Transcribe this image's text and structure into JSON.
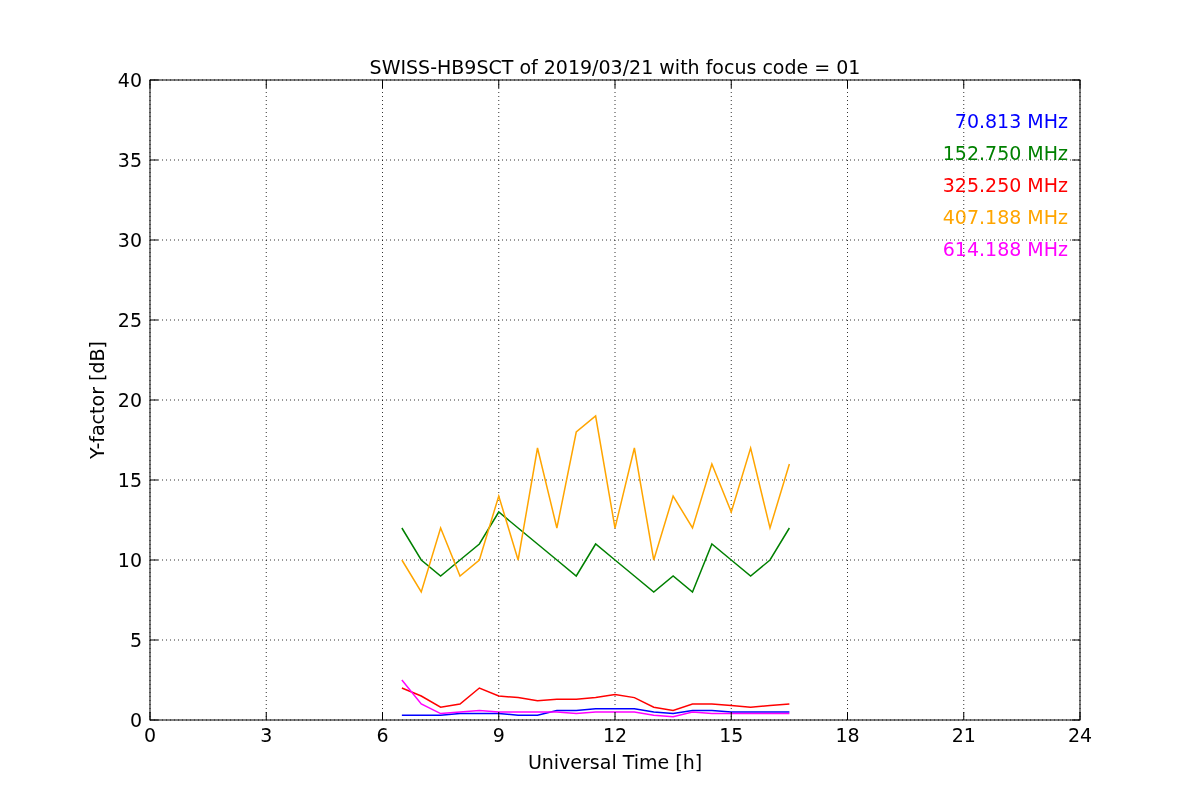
{
  "chart_data": {
    "type": "line",
    "title": "SWISS-HB9SCT of 2019/03/21 with focus code = 01",
    "xlabel": "Universal Time [h]",
    "ylabel": "Y-factor [dB]",
    "x": [
      6.5,
      7,
      7.5,
      8,
      8.5,
      9,
      9.5,
      10,
      10.5,
      11,
      11.5,
      12,
      12.5,
      13,
      13.5,
      14,
      14.5,
      15,
      15.5,
      16,
      16.5
    ],
    "series": [
      {
        "name": "70.813 MHz",
        "color": "#0000ff",
        "values": [
          0.3,
          0.3,
          0.3,
          0.4,
          0.4,
          0.4,
          0.3,
          0.3,
          0.6,
          0.6,
          0.7,
          0.7,
          0.7,
          0.5,
          0.4,
          0.6,
          0.6,
          0.5,
          0.5,
          0.5,
          0.5
        ]
      },
      {
        "name": "152.750 MHz",
        "color": "#008000",
        "values": [
          12,
          10,
          9,
          10,
          11,
          13,
          12,
          11,
          10,
          9,
          11,
          10,
          9,
          8,
          9,
          8,
          11,
          10,
          9,
          10,
          12
        ]
      },
      {
        "name": "325.250 MHz",
        "color": "#ff0000",
        "values": [
          2,
          1.5,
          0.8,
          1,
          2,
          1.5,
          1.4,
          1.2,
          1.3,
          1.3,
          1.4,
          1.6,
          1.4,
          0.8,
          0.6,
          1,
          1,
          0.9,
          0.8,
          0.9,
          1
        ]
      },
      {
        "name": "407.188 MHz",
        "color": "#ffa500",
        "values": [
          10,
          8,
          12,
          9,
          10,
          14,
          10,
          17,
          12,
          18,
          19,
          12,
          17,
          10,
          14,
          12,
          16,
          13,
          17,
          12,
          16
        ]
      },
      {
        "name": "614.188 MHz",
        "color": "#ff00ff",
        "values": [
          2.5,
          1,
          0.4,
          0.5,
          0.6,
          0.5,
          0.5,
          0.5,
          0.5,
          0.4,
          0.5,
          0.5,
          0.5,
          0.3,
          0.2,
          0.5,
          0.4,
          0.4,
          0.4,
          0.4,
          0.4
        ]
      }
    ],
    "xlim": [
      0,
      24
    ],
    "ylim": [
      0,
      40
    ],
    "xticks": [
      0,
      3,
      6,
      9,
      12,
      15,
      18,
      21,
      24
    ],
    "yticks": [
      0,
      5,
      10,
      15,
      20,
      25,
      30,
      35,
      40
    ],
    "grid": true
  }
}
